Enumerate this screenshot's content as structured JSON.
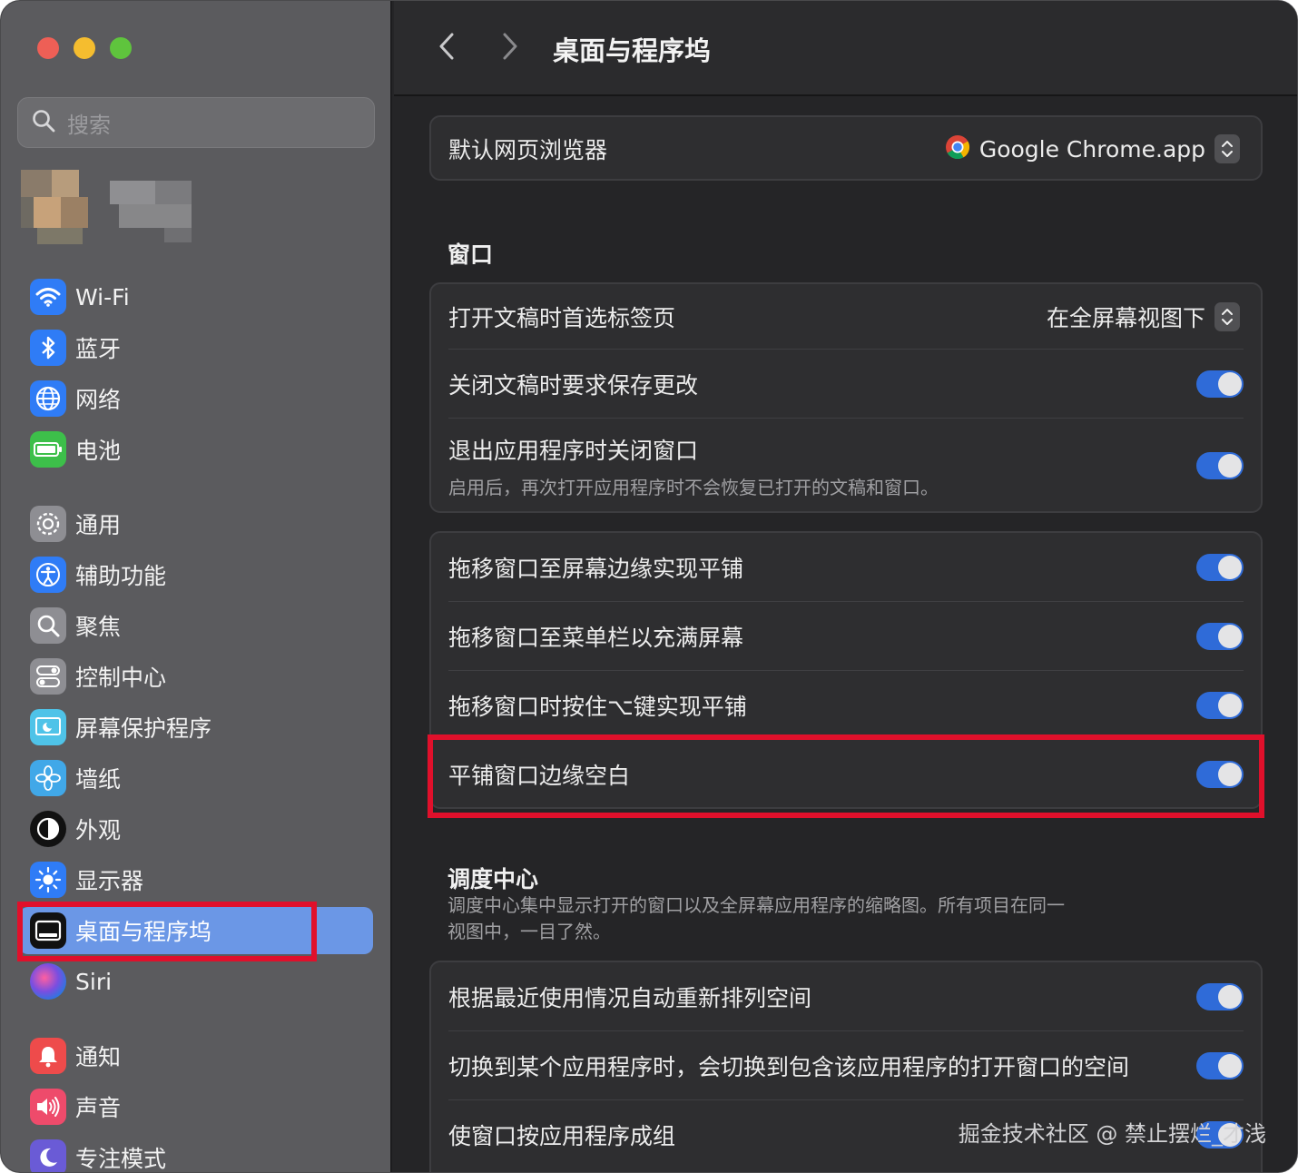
{
  "sidebar": {
    "search_placeholder": "搜索",
    "items": [
      {
        "label": "Wi-Fi",
        "icon": "wifi-icon",
        "color": "#2f7cf6"
      },
      {
        "label": "蓝牙",
        "icon": "bluetooth-icon",
        "color": "#2f7cf6"
      },
      {
        "label": "网络",
        "icon": "globe-icon",
        "color": "#2f7cf6"
      },
      {
        "label": "电池",
        "icon": "battery-icon",
        "color": "#3dbf4a"
      },
      {
        "label": "通用",
        "icon": "gear-icon",
        "color": "#8e8e93"
      },
      {
        "label": "辅助功能",
        "icon": "accessibility-icon",
        "color": "#2f7cf6"
      },
      {
        "label": "聚焦",
        "icon": "magnifier-icon",
        "color": "#8e8e93"
      },
      {
        "label": "控制中心",
        "icon": "toggles-icon",
        "color": "#8e8e93"
      },
      {
        "label": "屏幕保护程序",
        "icon": "screensaver-icon",
        "color": "#4fc3e8"
      },
      {
        "label": "墙纸",
        "icon": "flower-icon",
        "color": "#41a8e8"
      },
      {
        "label": "外观",
        "icon": "appearance-icon",
        "color": "#111111"
      },
      {
        "label": "显示器",
        "icon": "sun-icon",
        "color": "#2f7cf6"
      },
      {
        "label": "桌面与程序坞",
        "icon": "dock-icon",
        "color": "#111111"
      },
      {
        "label": "Siri",
        "icon": "siri-icon",
        "color": "#6d3fc9"
      },
      {
        "label": "通知",
        "icon": "bell-icon",
        "color": "#ee4b4b"
      },
      {
        "label": "声音",
        "icon": "speaker-icon",
        "color": "#ee4b6b"
      },
      {
        "label": "专注模式",
        "icon": "moon-icon",
        "color": "#6a5bd6"
      }
    ],
    "selected": "桌面与程序坞"
  },
  "toolbar": {
    "title": "桌面与程序坞"
  },
  "browser": {
    "label": "默认网页浏览器",
    "value": "Google Chrome.app"
  },
  "window_section": {
    "heading": "窗口",
    "group1": [
      {
        "label": "打开文稿时首选标签页",
        "value": "在全屏幕视图下"
      },
      {
        "label": "关闭文稿时要求保存更改",
        "toggle": "on"
      },
      {
        "label": "退出应用程序时关闭窗口",
        "sub": "启用后，再次打开应用程序时不会恢复已打开的文稿和窗口。",
        "toggle": "on"
      }
    ],
    "group2": [
      {
        "label": "拖移窗口至屏幕边缘实现平铺",
        "toggle": "on"
      },
      {
        "label": "拖移窗口至菜单栏以充满屏幕",
        "toggle": "on"
      },
      {
        "label": "拖移窗口时按住⌥键实现平铺",
        "toggle": "on"
      },
      {
        "label": "平铺窗口边缘空白",
        "toggle": "on"
      }
    ]
  },
  "mission_control": {
    "heading": "调度中心",
    "desc_line1": "调度中心集中显示打开的窗口以及全屏幕应用程序的缩略图。所有项目在同一",
    "desc_line2": "视图中，一目了然。",
    "items": [
      {
        "label": "根据最近使用情况自动重新排列空间",
        "toggle": "on"
      },
      {
        "label": "切换到某个应用程序时，会切换到包含该应用程序的打开窗口的空间",
        "toggle": "on"
      },
      {
        "label": "使窗口按应用程序成组",
        "toggle": "on"
      }
    ]
  },
  "watermark": "掘金技术社区 @ 禁止摆烂_才浅",
  "colors": {
    "accent": "#2f6bd8",
    "selection": "#6b97e6",
    "highlight": "#e0102b"
  }
}
